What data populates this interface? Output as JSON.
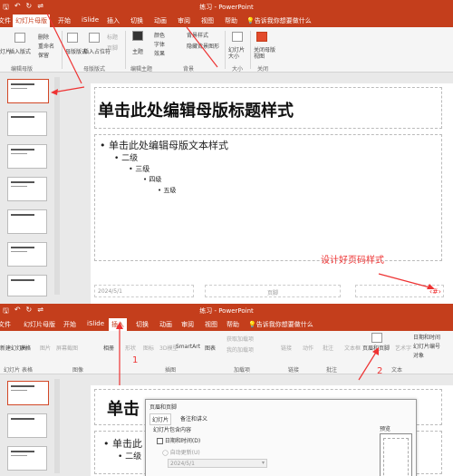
{
  "window": {
    "doc_title": "练习 - PowerPoint"
  },
  "colors": {
    "accent": "#c43e1c",
    "annotation": "#e33333"
  },
  "qat": {
    "save": "🖫",
    "undo": "↶",
    "redo": "↻",
    "more": "⇌"
  },
  "shot1": {
    "tabs": [
      "文件",
      "幻灯片母版",
      "开始",
      "iSlide",
      "插入",
      "切换",
      "动画",
      "审阅",
      "视图",
      "帮助"
    ],
    "tell_me": "告诉我你想要做什么",
    "ribbon": {
      "left_cut": "灯片",
      "insert_layout": "插入版式",
      "delete": "删除",
      "rename": "重命名",
      "preserve": "保留",
      "master_layout": "母版版式",
      "insert_placeholder": "插入占位符",
      "title": "标题",
      "footer": "页脚",
      "theme": "主题",
      "colors": "颜色",
      "fonts": "字体",
      "effects": "效果",
      "bg_styles": "背景样式",
      "hide_bg": "隐藏背景图形",
      "slide_size": "幻灯片大小",
      "close_master": "关闭母版视图",
      "groups": [
        "编辑母版",
        "母版版式",
        "编辑主题",
        "背景",
        "大小",
        "关闭"
      ]
    },
    "slide": {
      "title": "单击此处编辑母版标题样式",
      "levels": [
        "单击此处编辑母版文本样式",
        "二级",
        "三级",
        "四级",
        "五级"
      ],
      "footer_date": "2024/5/1",
      "footer_text": "页脚",
      "page_num": "‹#›"
    },
    "annotation": "设计好页码样式"
  },
  "shot2": {
    "tabs": [
      "文件",
      "幻灯片母版",
      "开始",
      "iSlide",
      "插入",
      "切换",
      "动画",
      "审阅",
      "视图",
      "帮助"
    ],
    "tell_me": "告诉我你想要做什么",
    "ribbon": {
      "items": [
        "新建幻灯片",
        "表格",
        "图片",
        "屏幕截图",
        "相册",
        "形状",
        "图标",
        "3D模型",
        "SmartArt",
        "图表",
        "获取加载项",
        "我的加载项",
        "链接",
        "动作",
        "批注",
        "文本框",
        "页眉和页脚",
        "艺术字",
        "日期和时间",
        "幻灯片编号",
        "对象"
      ],
      "groups": [
        "幻灯片",
        "表格",
        "图像",
        "插图",
        "加载项",
        "链接",
        "批注",
        "文本"
      ]
    },
    "slide": {
      "title": "单击",
      "level1": "单击此",
      "level2": "二级"
    },
    "dialog": {
      "title": "页眉和页脚",
      "tabs": [
        "幻灯片",
        "备注和讲义"
      ],
      "section": "幻灯片包含内容",
      "datetime": "日期和时间(D)",
      "auto_update": "自动更新(U)",
      "date_value": "2024/5/1",
      "preview": "预览"
    },
    "labels": [
      "1",
      "2"
    ]
  }
}
